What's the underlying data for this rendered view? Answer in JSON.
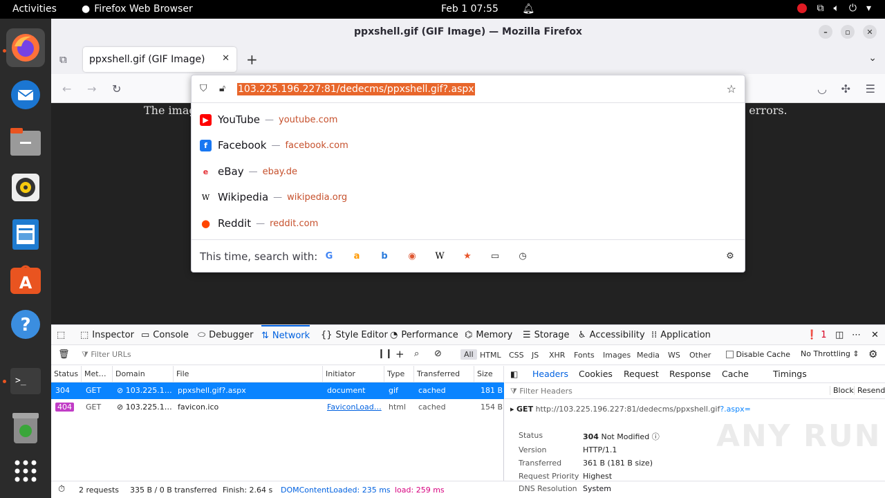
{
  "topbar": {
    "activities": "Activities",
    "app_name": "Firefox Web Browser",
    "clock": "Feb 1  07:55"
  },
  "window": {
    "title": "ppxshell.gif (GIF Image) — Mozilla Firefox",
    "tab_title": "ppxshell.gif (GIF Image)"
  },
  "content": {
    "message_left": "The imag",
    "message_right": "s errors."
  },
  "urlbar": {
    "url": "103.225.196.227:81/dedecms/ppxshell.gif?.aspx",
    "suggestions": [
      {
        "name": "YouTube",
        "domain": "youtube.com",
        "icon": "youtube-icon",
        "color": "#ff0000"
      },
      {
        "name": "Facebook",
        "domain": "facebook.com",
        "icon": "facebook-icon",
        "color": "#1877f2"
      },
      {
        "name": "eBay",
        "domain": "ebay.de",
        "icon": "ebay-icon",
        "color": "#e53238"
      },
      {
        "name": "Wikipedia",
        "domain": "wikipedia.org",
        "icon": "wikipedia-icon",
        "color": "#000000"
      },
      {
        "name": "Reddit",
        "domain": "reddit.com",
        "icon": "reddit-icon",
        "color": "#ff4500"
      }
    ],
    "search_with_label": "This time, search with:"
  },
  "devtools": {
    "tabs": [
      "Inspector",
      "Console",
      "Debugger",
      "Network",
      "Style Editor",
      "Performance",
      "Memory",
      "Storage",
      "Accessibility",
      "Application"
    ],
    "selected_tab": "Network",
    "error_count": "1",
    "filter_placeholder": "Filter URLs",
    "filter_types": [
      "All",
      "HTML",
      "CSS",
      "JS",
      "XHR",
      "Fonts",
      "Images",
      "Media",
      "WS",
      "Other"
    ],
    "disable_cache": "Disable Cache",
    "throttling": "No Throttling ⇕",
    "columns": [
      "Status",
      "Met…",
      "Domain",
      "File",
      "Initiator",
      "Type",
      "Transferred",
      "Size"
    ],
    "requests": [
      {
        "status": "304",
        "method": "GET",
        "domain": "103.225.1…",
        "file": "ppxshell.gif?.aspx",
        "initiator": "document",
        "type": "gif",
        "transferred": "cached",
        "size": "181 B"
      },
      {
        "status": "404",
        "method": "GET",
        "domain": "103.225.1…",
        "file": "favicon.ico",
        "initiator": "FaviconLoad…",
        "type": "html",
        "transferred": "cached",
        "size": "154 B"
      }
    ],
    "side_tabs": [
      "Headers",
      "Cookies",
      "Request",
      "Response",
      "Cache",
      "Timings"
    ],
    "filter_headers": "Filter Headers",
    "block": "Block",
    "resend": "Resend",
    "request_method": "GET",
    "request_url": "http://103.225.196.227:81/dedecms/ppxshell.gif",
    "request_url_query": "?.aspx=",
    "details": {
      "status_label": "Status",
      "status_code": "304",
      "status_text": "Not Modified",
      "version_label": "Version",
      "version": "HTTP/1.1",
      "transferred_label": "Transferred",
      "transferred": "361 B (181 B size)",
      "priority_label": "Request Priority",
      "priority": "Highest",
      "dns_label": "DNS Resolution",
      "dns": "System"
    },
    "status": {
      "requests": "2 requests",
      "transferred": "335 B / 0 B transferred",
      "finish": "Finish: 2.64 s",
      "dcl": "DOMContentLoaded: 235 ms",
      "load": "load: 259 ms"
    }
  },
  "watermark": "ANY RUN",
  "colors": {
    "accent": "#0a84ff",
    "url_highlight": "#e8662b",
    "ubuntu_orange": "#e95420"
  }
}
